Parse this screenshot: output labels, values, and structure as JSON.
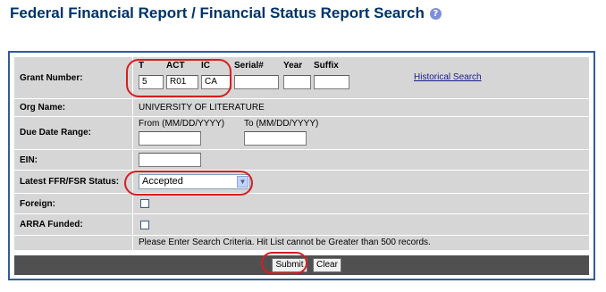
{
  "page": {
    "title": "Federal Financial Report / Financial Status Report Search",
    "help_icon": "help-icon"
  },
  "grant": {
    "label": "Grant Number:",
    "t_label": "T",
    "act_label": "ACT",
    "ic_label": "IC",
    "serial_label": "Serial#",
    "year_label": "Year",
    "suffix_label": "Suffix",
    "t_value": "5",
    "act_value": "R01",
    "ic_value": "CA",
    "serial_value": "",
    "year_value": "",
    "suffix_value": "",
    "historical_link": "Historical Search"
  },
  "org": {
    "label": "Org Name:",
    "value": "UNIVERSITY OF LITERATURE"
  },
  "due_date": {
    "label": "Due Date Range:",
    "from_label": "From (MM/DD/YYYY)",
    "to_label": "To (MM/DD/YYYY)",
    "from_value": "",
    "to_value": ""
  },
  "ein": {
    "label": "EIN:",
    "value": ""
  },
  "status": {
    "label": "Latest FFR/FSR Status:",
    "selected": "Accepted"
  },
  "foreign": {
    "label": "Foreign:",
    "checked": false
  },
  "arra": {
    "label": "ARRA Funded:",
    "checked": false
  },
  "message": "Please Enter Search Criteria. Hit List cannot be Greater than 500 records.",
  "buttons": {
    "submit": "Submit",
    "clear": "Clear"
  },
  "colors": {
    "title": "#003366",
    "row_bg": "#d6d6d6",
    "border": "#335b9a",
    "annotation": "#d81e1e",
    "footer_bar": "#505050"
  }
}
